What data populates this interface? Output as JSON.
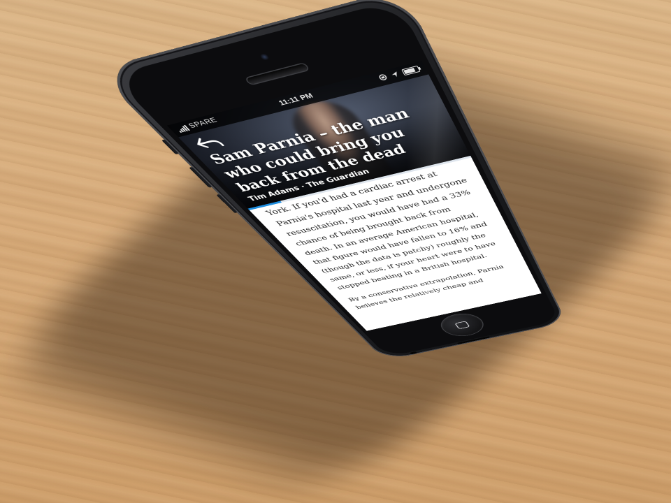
{
  "status_bar": {
    "carrier": "SPARE",
    "time": "11:11 PM",
    "signal_bars": 5,
    "battery_level": 0.8,
    "icons": [
      "signal-bars-icon",
      "lock-rotation-icon",
      "location-arrow-icon",
      "battery-icon"
    ]
  },
  "header": {
    "back_icon": "back-arrow-icon",
    "headline": "Sam Parnia – the man who could bring you back from the dead",
    "byline": "Tim Adams · The Guardian",
    "reading_progress": 0.15
  },
  "article": {
    "paragraphs": [
      "York. If you'd had a cardiac arrest at Parnia's hospital last year and undergone resuscitation, you would have had a 33% chance of being brought back from death. In an average American hospital, that figure would have fallen to 16% and (though the data is patchy) roughly the same, or less, if your heart were to have stopped beating in a British hospital.",
      "By a conservative extrapolation, Parnia believes the relatively cheap and"
    ]
  },
  "device": {
    "home_icon": "home-square-icon"
  },
  "colors": {
    "accent": "#1f8ee0",
    "phone_body": "#1d1e21",
    "table_wood": "#d9ad7c"
  }
}
